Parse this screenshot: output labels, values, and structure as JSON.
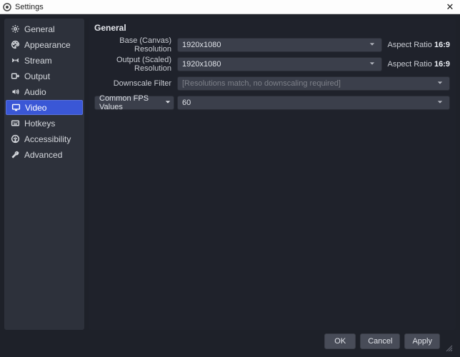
{
  "titlebar": {
    "title": "Settings"
  },
  "sidebar": {
    "items": [
      {
        "label": "General"
      },
      {
        "label": "Appearance"
      },
      {
        "label": "Stream"
      },
      {
        "label": "Output"
      },
      {
        "label": "Audio"
      },
      {
        "label": "Video"
      },
      {
        "label": "Hotkeys"
      },
      {
        "label": "Accessibility"
      },
      {
        "label": "Advanced"
      }
    ]
  },
  "panel": {
    "title": "General",
    "base_res_label": "Base (Canvas) Resolution",
    "base_res_value": "1920x1080",
    "base_aspect_label": "Aspect Ratio",
    "base_aspect_value": "16:9",
    "output_res_label": "Output (Scaled) Resolution",
    "output_res_value": "1920x1080",
    "output_aspect_label": "Aspect Ratio",
    "output_aspect_value": "16:9",
    "downscale_label": "Downscale Filter",
    "downscale_value": "[Resolutions match, no downscaling required]",
    "fps_mode_label": "Common FPS Values",
    "fps_value": "60"
  },
  "footer": {
    "ok": "OK",
    "cancel": "Cancel",
    "apply": "Apply"
  }
}
